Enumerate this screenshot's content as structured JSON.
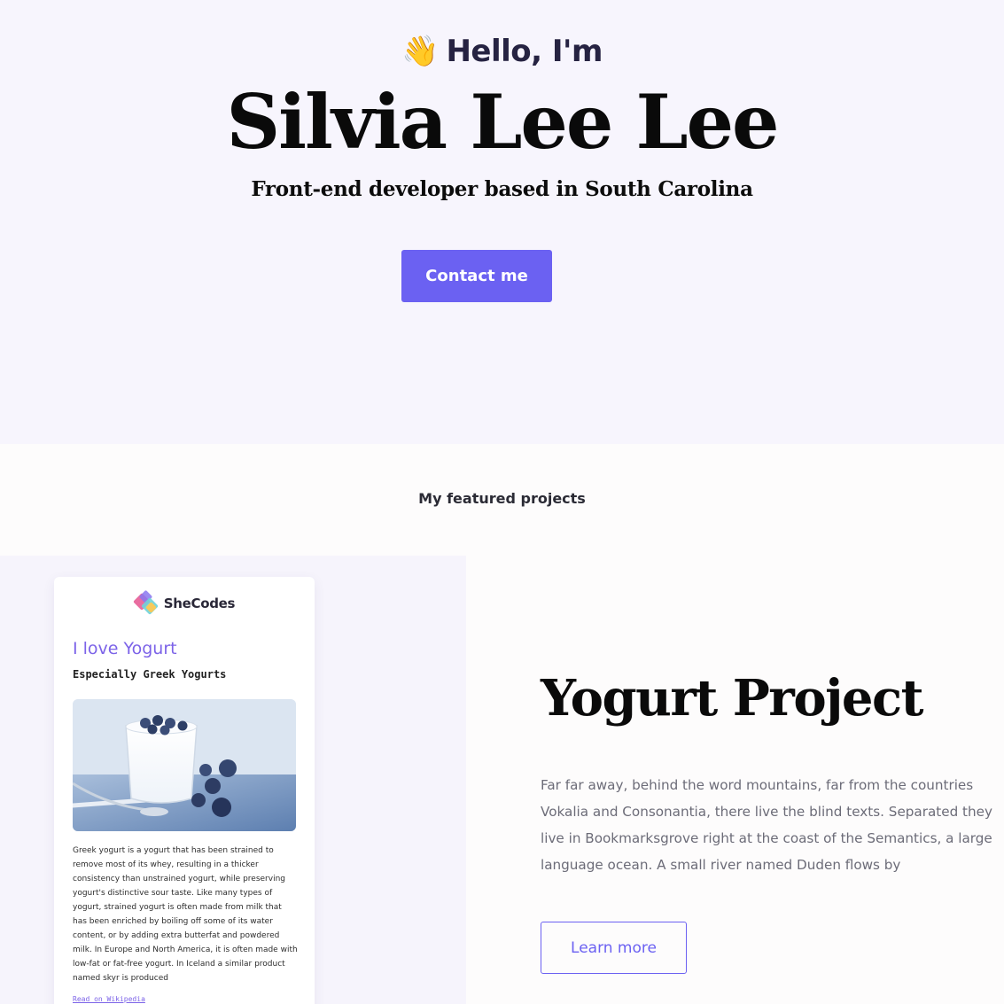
{
  "hero": {
    "wave_emoji": "👋",
    "greeting": "Hello, I'm",
    "name": "Silvia Lee Lee",
    "subtitle": "Front-end developer based in South Carolina",
    "contact_label": "Contact me",
    "colors": {
      "background": "#f7f5fd",
      "accent": "#6b61f2"
    }
  },
  "projects": {
    "heading": "My featured projects",
    "featured": {
      "title": "Yogurt Project",
      "description": "Far far away, behind the word mountains, far from the countries Vokalia and Consonantia, there live the blind texts. Separated they live in Bookmarksgrove right at the coast of the Semantics, a large language ocean. A small river named Duden flows by",
      "button_label": "Learn more",
      "preview": {
        "logo_text": "SheCodes",
        "title": "I love Yogurt",
        "subtitle": "Especially Greek Yogurts",
        "body": "Greek yogurt is a yogurt that has been strained to remove most of its whey, resulting in a thicker consistency than unstrained yogurt, while preserving yogurt's distinctive sour taste. Like many types of yogurt, strained yogurt is often made from milk that has been enriched by boiling off some of its water content, or by adding extra butterfat and powdered milk. In Europe and North America, it is often made with low-fat or fat-free yogurt. In Iceland a similar product named skyr is produced",
        "link_label": "Read on Wikipedia",
        "accent": "#7c63e8"
      }
    }
  }
}
